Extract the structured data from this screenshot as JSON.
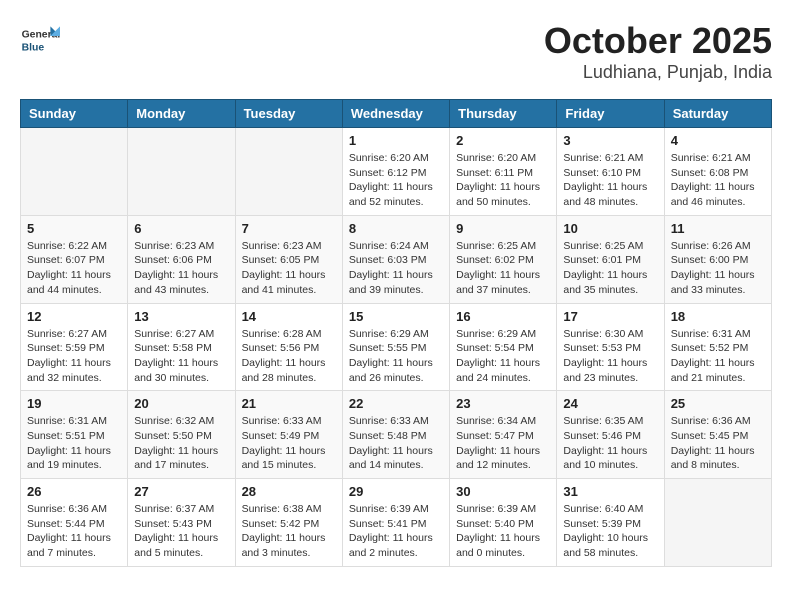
{
  "header": {
    "logo_general": "General",
    "logo_blue": "Blue",
    "month": "October 2025",
    "location": "Ludhiana, Punjab, India"
  },
  "days_of_week": [
    "Sunday",
    "Monday",
    "Tuesday",
    "Wednesday",
    "Thursday",
    "Friday",
    "Saturday"
  ],
  "weeks": [
    [
      {
        "day": "",
        "info": ""
      },
      {
        "day": "",
        "info": ""
      },
      {
        "day": "",
        "info": ""
      },
      {
        "day": "1",
        "info": "Sunrise: 6:20 AM\nSunset: 6:12 PM\nDaylight: 11 hours\nand 52 minutes."
      },
      {
        "day": "2",
        "info": "Sunrise: 6:20 AM\nSunset: 6:11 PM\nDaylight: 11 hours\nand 50 minutes."
      },
      {
        "day": "3",
        "info": "Sunrise: 6:21 AM\nSunset: 6:10 PM\nDaylight: 11 hours\nand 48 minutes."
      },
      {
        "day": "4",
        "info": "Sunrise: 6:21 AM\nSunset: 6:08 PM\nDaylight: 11 hours\nand 46 minutes."
      }
    ],
    [
      {
        "day": "5",
        "info": "Sunrise: 6:22 AM\nSunset: 6:07 PM\nDaylight: 11 hours\nand 44 minutes."
      },
      {
        "day": "6",
        "info": "Sunrise: 6:23 AM\nSunset: 6:06 PM\nDaylight: 11 hours\nand 43 minutes."
      },
      {
        "day": "7",
        "info": "Sunrise: 6:23 AM\nSunset: 6:05 PM\nDaylight: 11 hours\nand 41 minutes."
      },
      {
        "day": "8",
        "info": "Sunrise: 6:24 AM\nSunset: 6:03 PM\nDaylight: 11 hours\nand 39 minutes."
      },
      {
        "day": "9",
        "info": "Sunrise: 6:25 AM\nSunset: 6:02 PM\nDaylight: 11 hours\nand 37 minutes."
      },
      {
        "day": "10",
        "info": "Sunrise: 6:25 AM\nSunset: 6:01 PM\nDaylight: 11 hours\nand 35 minutes."
      },
      {
        "day": "11",
        "info": "Sunrise: 6:26 AM\nSunset: 6:00 PM\nDaylight: 11 hours\nand 33 minutes."
      }
    ],
    [
      {
        "day": "12",
        "info": "Sunrise: 6:27 AM\nSunset: 5:59 PM\nDaylight: 11 hours\nand 32 minutes."
      },
      {
        "day": "13",
        "info": "Sunrise: 6:27 AM\nSunset: 5:58 PM\nDaylight: 11 hours\nand 30 minutes."
      },
      {
        "day": "14",
        "info": "Sunrise: 6:28 AM\nSunset: 5:56 PM\nDaylight: 11 hours\nand 28 minutes."
      },
      {
        "day": "15",
        "info": "Sunrise: 6:29 AM\nSunset: 5:55 PM\nDaylight: 11 hours\nand 26 minutes."
      },
      {
        "day": "16",
        "info": "Sunrise: 6:29 AM\nSunset: 5:54 PM\nDaylight: 11 hours\nand 24 minutes."
      },
      {
        "day": "17",
        "info": "Sunrise: 6:30 AM\nSunset: 5:53 PM\nDaylight: 11 hours\nand 23 minutes."
      },
      {
        "day": "18",
        "info": "Sunrise: 6:31 AM\nSunset: 5:52 PM\nDaylight: 11 hours\nand 21 minutes."
      }
    ],
    [
      {
        "day": "19",
        "info": "Sunrise: 6:31 AM\nSunset: 5:51 PM\nDaylight: 11 hours\nand 19 minutes."
      },
      {
        "day": "20",
        "info": "Sunrise: 6:32 AM\nSunset: 5:50 PM\nDaylight: 11 hours\nand 17 minutes."
      },
      {
        "day": "21",
        "info": "Sunrise: 6:33 AM\nSunset: 5:49 PM\nDaylight: 11 hours\nand 15 minutes."
      },
      {
        "day": "22",
        "info": "Sunrise: 6:33 AM\nSunset: 5:48 PM\nDaylight: 11 hours\nand 14 minutes."
      },
      {
        "day": "23",
        "info": "Sunrise: 6:34 AM\nSunset: 5:47 PM\nDaylight: 11 hours\nand 12 minutes."
      },
      {
        "day": "24",
        "info": "Sunrise: 6:35 AM\nSunset: 5:46 PM\nDaylight: 11 hours\nand 10 minutes."
      },
      {
        "day": "25",
        "info": "Sunrise: 6:36 AM\nSunset: 5:45 PM\nDaylight: 11 hours\nand 8 minutes."
      }
    ],
    [
      {
        "day": "26",
        "info": "Sunrise: 6:36 AM\nSunset: 5:44 PM\nDaylight: 11 hours\nand 7 minutes."
      },
      {
        "day": "27",
        "info": "Sunrise: 6:37 AM\nSunset: 5:43 PM\nDaylight: 11 hours\nand 5 minutes."
      },
      {
        "day": "28",
        "info": "Sunrise: 6:38 AM\nSunset: 5:42 PM\nDaylight: 11 hours\nand 3 minutes."
      },
      {
        "day": "29",
        "info": "Sunrise: 6:39 AM\nSunset: 5:41 PM\nDaylight: 11 hours\nand 2 minutes."
      },
      {
        "day": "30",
        "info": "Sunrise: 6:39 AM\nSunset: 5:40 PM\nDaylight: 11 hours\nand 0 minutes."
      },
      {
        "day": "31",
        "info": "Sunrise: 6:40 AM\nSunset: 5:39 PM\nDaylight: 10 hours\nand 58 minutes."
      },
      {
        "day": "",
        "info": ""
      }
    ]
  ]
}
